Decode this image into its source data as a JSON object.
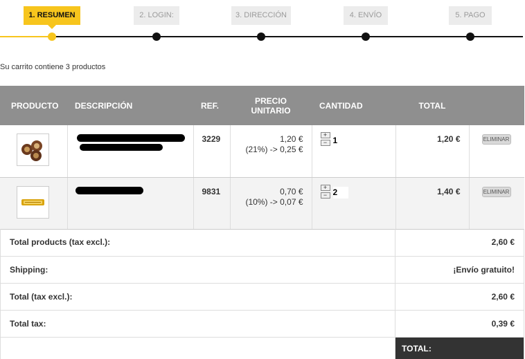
{
  "steps": [
    {
      "label": "1. RESUMEN",
      "active": true
    },
    {
      "label": "2. LOGIN:",
      "active": false
    },
    {
      "label": "3. DIRECCIÓN",
      "active": false
    },
    {
      "label": "4. ENVÍO",
      "active": false
    },
    {
      "label": "5. PAGO",
      "active": false
    }
  ],
  "summary_text": "Su carrito contiene 3 productos",
  "table": {
    "headers": {
      "product": "PRODUCTO",
      "description": "DESCRIPCIÓN",
      "ref": "REF.",
      "unit_price": "PRECIO UNITARIO",
      "quantity": "CANTIDAD",
      "total": "TOTAL"
    },
    "rows": [
      {
        "ref": "3229",
        "price": "1,20 €",
        "tax": "(21%) -> 0,25 €",
        "quantity": "1",
        "total": "1,20 €",
        "delete_label": "ELIMINAR",
        "image": "chocolates-thumbnail"
      },
      {
        "ref": "9831",
        "price": "0,70 €",
        "tax": "(10%) -> 0,07 €",
        "quantity": "2",
        "total": "1,40 €",
        "delete_label": "ELIMINAR",
        "image": "candy-wrapper-thumbnail"
      }
    ],
    "plus_icon": "+",
    "minus_icon": "−"
  },
  "totals": {
    "products_label": "Total products (tax excl.):",
    "products_value": "2,60 €",
    "shipping_label": "Shipping:",
    "shipping_value": "¡Envío gratuito!",
    "tax_excl_label": "Total (tax excl.):",
    "tax_excl_value": "2,60 €",
    "tax_label": "Total tax:",
    "tax_value": "0,39 €",
    "grand_label": "TOTAL:"
  },
  "colors": {
    "accent": "#f7c51d",
    "header_bg": "#8f8f8f",
    "grand_total_bg": "#333333"
  }
}
